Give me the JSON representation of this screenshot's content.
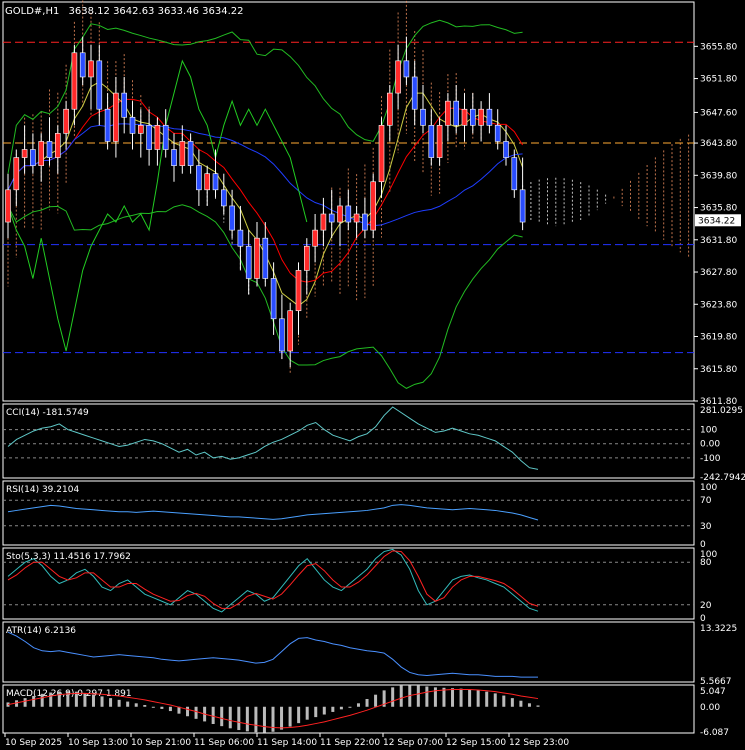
{
  "header": {
    "symbol": "GOLD#,H1",
    "ohlc": "3638.12 3642.63 3633.46 3634.22",
    "current_price": "3634.22"
  },
  "colors": {
    "background": "#000000",
    "grid_border": "#ffffff",
    "bull_candle": "#ff2a2a",
    "bear_candle": "#2a4dff",
    "wick": "#ffffff",
    "cloud_up": "#ff9966",
    "cloud_down": "#ffffff",
    "tenkan": "#ff0000",
    "kijun": "#1f3dff",
    "chikou": "#22cc22",
    "bollinger": "#22bb22",
    "ma": "#cccc44",
    "cci": "#5fc8c8",
    "rsi": "#4aa0ff",
    "sto_main": "#33bbbb",
    "sto_signal": "#ff2222",
    "atr": "#4a90ff",
    "macd_hist": "#bbbbbb",
    "macd_signal": "#ff2222",
    "level_red": "#ff2222",
    "level_orange": "#ffaa33",
    "level_blue": "#2233ff"
  },
  "chart_data": [
    {
      "type": "candlestick",
      "title": "GOLD#,H1",
      "ylim": [
        3611.8,
        3661.3
      ],
      "y_ticks": [
        "3655.80",
        "3651.80",
        "3647.60",
        "3643.80",
        "3639.80",
        "3635.80",
        "3631.80",
        "3627.80",
        "3623.80",
        "3619.80",
        "3615.80",
        "3611.80"
      ],
      "x_ticks": [
        "10 Sep 2025",
        "10 Sep 13:00",
        "10 Sep 21:00",
        "11 Sep 06:00",
        "11 Sep 14:00",
        "11 Sep 22:00",
        "12 Sep 07:00",
        "12 Sep 15:00",
        "12 Sep 23:00"
      ],
      "levels": [
        {
          "price": 3656.3,
          "style": "dashed",
          "color": "red"
        },
        {
          "price": 3643.8,
          "style": "dashed",
          "color": "orange"
        },
        {
          "price": 3631.2,
          "style": "dashed",
          "color": "blue"
        },
        {
          "price": 3617.8,
          "style": "dashed",
          "color": "blue"
        }
      ],
      "candles": [
        [
          3634,
          3640,
          3632,
          3638
        ],
        [
          3638,
          3643,
          3636,
          3642
        ],
        [
          3642,
          3646,
          3640,
          3643
        ],
        [
          3643,
          3645,
          3640,
          3641
        ],
        [
          3641,
          3645,
          3639,
          3644
        ],
        [
          3644,
          3647,
          3641,
          3642
        ],
        [
          3642,
          3646,
          3640,
          3645
        ],
        [
          3645,
          3649,
          3643,
          3648
        ],
        [
          3648,
          3656,
          3646,
          3655
        ],
        [
          3655,
          3657,
          3651,
          3652
        ],
        [
          3652,
          3656,
          3648,
          3654
        ],
        [
          3654,
          3656,
          3646,
          3648
        ],
        [
          3648,
          3650,
          3643,
          3644
        ],
        [
          3644,
          3652,
          3642,
          3650
        ],
        [
          3650,
          3652,
          3645,
          3647
        ],
        [
          3647,
          3649,
          3643,
          3645
        ],
        [
          3645,
          3648,
          3642,
          3646
        ],
        [
          3646,
          3648,
          3641,
          3643
        ],
        [
          3643,
          3647,
          3641,
          3646
        ],
        [
          3646,
          3648,
          3642,
          3643
        ],
        [
          3643,
          3645,
          3639,
          3641
        ],
        [
          3641,
          3646,
          3640,
          3644
        ],
        [
          3644,
          3645,
          3640,
          3641
        ],
        [
          3641,
          3643,
          3636,
          3638
        ],
        [
          3638,
          3641,
          3636,
          3640
        ],
        [
          3640,
          3643,
          3637,
          3638
        ],
        [
          3638,
          3640,
          3635,
          3636
        ],
        [
          3636,
          3638,
          3632,
          3633
        ],
        [
          3633,
          3636,
          3628,
          3631
        ],
        [
          3631,
          3633,
          3625,
          3627
        ],
        [
          3627,
          3634,
          3626,
          3632
        ],
        [
          3632,
          3634,
          3626,
          3627
        ],
        [
          3627,
          3629,
          3620,
          3622
        ],
        [
          3622,
          3625,
          3617,
          3618
        ],
        [
          3618,
          3624,
          3616,
          3623
        ],
        [
          3623,
          3629,
          3620,
          3628
        ],
        [
          3628,
          3632,
          3625,
          3631
        ],
        [
          3631,
          3635,
          3629,
          3633
        ],
        [
          3633,
          3637,
          3631,
          3635
        ],
        [
          3635,
          3638,
          3632,
          3634
        ],
        [
          3634,
          3637,
          3631,
          3636
        ],
        [
          3636,
          3638,
          3633,
          3634
        ],
        [
          3634,
          3636,
          3632,
          3635
        ],
        [
          3635,
          3637,
          3632,
          3633
        ],
        [
          3633,
          3640,
          3632,
          3639
        ],
        [
          3639,
          3647,
          3637,
          3646
        ],
        [
          3646,
          3651,
          3644,
          3650
        ],
        [
          3650,
          3656,
          3648,
          3654
        ],
        [
          3654,
          3657,
          3651,
          3652
        ],
        [
          3652,
          3654,
          3646,
          3648
        ],
        [
          3648,
          3651,
          3645,
          3646
        ],
        [
          3646,
          3648,
          3641,
          3642
        ],
        [
          3642,
          3647,
          3641,
          3646
        ],
        [
          3646,
          3650,
          3644,
          3649
        ],
        [
          3649,
          3651,
          3645,
          3646
        ],
        [
          3646,
          3650,
          3644,
          3648
        ],
        [
          3648,
          3650,
          3645,
          3646
        ],
        [
          3646,
          3649,
          3644,
          3648
        ],
        [
          3648,
          3650,
          3645,
          3646
        ],
        [
          3646,
          3648,
          3643,
          3644
        ],
        [
          3644,
          3646,
          3641,
          3642
        ],
        [
          3642,
          3643,
          3637,
          3638
        ],
        [
          3638,
          3642,
          3633,
          3634
        ]
      ]
    },
    {
      "type": "line",
      "title": "CCI(14) -181.5749",
      "ylim": [
        -242.7942,
        281.0295
      ],
      "y_ticks": [
        "281.0295",
        "100",
        "0.00",
        "-100",
        "-242.7942"
      ],
      "levels": [
        100,
        0,
        -100
      ],
      "values": [
        -20,
        30,
        60,
        90,
        110,
        120,
        140,
        100,
        80,
        60,
        40,
        20,
        0,
        -20,
        -10,
        10,
        30,
        20,
        0,
        -30,
        -60,
        -40,
        -80,
        -60,
        -100,
        -90,
        -110,
        -100,
        -80,
        -60,
        -20,
        10,
        30,
        60,
        90,
        130,
        150,
        100,
        60,
        40,
        20,
        50,
        70,
        120,
        200,
        260,
        220,
        180,
        140,
        110,
        80,
        90,
        110,
        90,
        70,
        60,
        40,
        20,
        -20,
        -60,
        -120,
        -170,
        -182
      ]
    },
    {
      "type": "line",
      "title": "RSI(14) 39.2104",
      "ylim": [
        0,
        100
      ],
      "y_ticks": [
        "100",
        "70",
        "30",
        "0"
      ],
      "levels": [
        70,
        30
      ],
      "values": [
        52,
        54,
        56,
        58,
        60,
        62,
        61,
        59,
        57,
        56,
        55,
        54,
        53,
        52,
        52,
        51,
        52,
        53,
        52,
        51,
        50,
        49,
        48,
        47,
        46,
        45,
        44,
        44,
        43,
        42,
        41,
        40,
        41,
        43,
        45,
        47,
        48,
        49,
        50,
        51,
        52,
        53,
        54,
        56,
        58,
        62,
        63,
        62,
        60,
        58,
        57,
        56,
        55,
        56,
        57,
        56,
        55,
        54,
        52,
        50,
        47,
        43,
        39
      ]
    },
    {
      "type": "line",
      "title": "Sto(5,3,3) 11.4516 17.7962",
      "ylim": [
        0,
        100
      ],
      "y_ticks": [
        "100",
        "80",
        "20",
        "0"
      ],
      "levels": [
        80,
        20
      ],
      "series": [
        {
          "name": "main",
          "values": [
            60,
            70,
            80,
            85,
            75,
            60,
            50,
            55,
            65,
            70,
            60,
            45,
            40,
            50,
            55,
            45,
            35,
            30,
            25,
            20,
            30,
            40,
            35,
            25,
            15,
            10,
            20,
            30,
            40,
            35,
            25,
            30,
            45,
            60,
            75,
            85,
            70,
            55,
            45,
            40,
            50,
            60,
            70,
            85,
            95,
            98,
            90,
            70,
            40,
            20,
            25,
            40,
            55,
            60,
            62,
            58,
            55,
            50,
            45,
            35,
            25,
            15,
            11
          ]
        },
        {
          "name": "signal",
          "values": [
            55,
            62,
            72,
            80,
            80,
            70,
            60,
            55,
            58,
            65,
            65,
            55,
            45,
            45,
            50,
            50,
            42,
            35,
            30,
            25,
            26,
            33,
            36,
            32,
            22,
            15,
            15,
            22,
            32,
            36,
            32,
            28,
            35,
            48,
            62,
            75,
            78,
            68,
            55,
            45,
            45,
            52,
            62,
            75,
            88,
            96,
            95,
            82,
            60,
            35,
            25,
            30,
            45,
            55,
            60,
            60,
            57,
            54,
            50,
            42,
            32,
            22,
            18
          ]
        }
      ]
    },
    {
      "type": "line",
      "title": "ATR(14) 6.2136",
      "ylim": [
        5.5667,
        13.3225
      ],
      "y_ticks": [
        "13.3225",
        "5.5667"
      ],
      "values": [
        12.0,
        11.5,
        10.8,
        10.0,
        9.6,
        9.5,
        9.6,
        9.4,
        9.2,
        9.0,
        8.8,
        8.9,
        9.0,
        9.1,
        9.0,
        8.9,
        8.8,
        8.7,
        8.5,
        8.4,
        8.3,
        8.4,
        8.5,
        8.6,
        8.7,
        8.6,
        8.5,
        8.4,
        8.2,
        8.0,
        8.1,
        8.5,
        9.5,
        10.5,
        11.2,
        11.3,
        11.0,
        10.8,
        10.5,
        10.3,
        10.0,
        9.8,
        9.6,
        9.5,
        9.3,
        8.5,
        7.5,
        6.8,
        6.5,
        6.4,
        6.5,
        6.6,
        6.7,
        6.6,
        6.5,
        6.5,
        6.4,
        6.3,
        6.3,
        6.3,
        6.2,
        6.2,
        6.2
      ]
    },
    {
      "type": "bar",
      "title": "MACD(12,26,9) 0.297 1.891",
      "ylim": [
        -6.087,
        5.047
      ],
      "y_ticks": [
        "5.047",
        "0.00",
        "-6.087"
      ],
      "series": [
        {
          "name": "histogram",
          "values": [
            1.0,
            1.5,
            2.0,
            2.5,
            3.0,
            3.3,
            3.5,
            3.6,
            3.5,
            3.2,
            2.8,
            2.4,
            2.0,
            1.6,
            1.2,
            0.8,
            0.4,
            0.0,
            -0.5,
            -1.0,
            -1.6,
            -2.2,
            -2.8,
            -3.4,
            -4.0,
            -4.5,
            -5.0,
            -5.4,
            -5.7,
            -5.9,
            -6.0,
            -5.8,
            -5.3,
            -4.6,
            -3.8,
            -3.0,
            -2.4,
            -1.8,
            -1.2,
            -0.6,
            0.0,
            0.8,
            1.8,
            2.8,
            3.8,
            4.5,
            4.9,
            5.0,
            4.9,
            4.7,
            4.5,
            4.4,
            4.3,
            4.2,
            4.0,
            3.8,
            3.5,
            3.1,
            2.6,
            2.0,
            1.4,
            0.8,
            0.3
          ]
        },
        {
          "name": "signal",
          "values": [
            0.5,
            0.9,
            1.3,
            1.7,
            2.1,
            2.5,
            2.8,
            3.0,
            3.1,
            3.1,
            3.0,
            2.9,
            2.7,
            2.5,
            2.2,
            1.9,
            1.6,
            1.2,
            0.8,
            0.4,
            -0.1,
            -0.6,
            -1.1,
            -1.7,
            -2.2,
            -2.7,
            -3.2,
            -3.6,
            -4.0,
            -4.3,
            -4.6,
            -4.8,
            -4.9,
            -4.8,
            -4.6,
            -4.3,
            -3.9,
            -3.5,
            -3.0,
            -2.5,
            -2.0,
            -1.4,
            -0.8,
            -0.1,
            0.6,
            1.3,
            2.0,
            2.6,
            3.0,
            3.4,
            3.7,
            3.9,
            4.0,
            4.0,
            4.0,
            3.9,
            3.7,
            3.5,
            3.2,
            2.9,
            2.5,
            2.2,
            1.9
          ]
        }
      ]
    }
  ]
}
